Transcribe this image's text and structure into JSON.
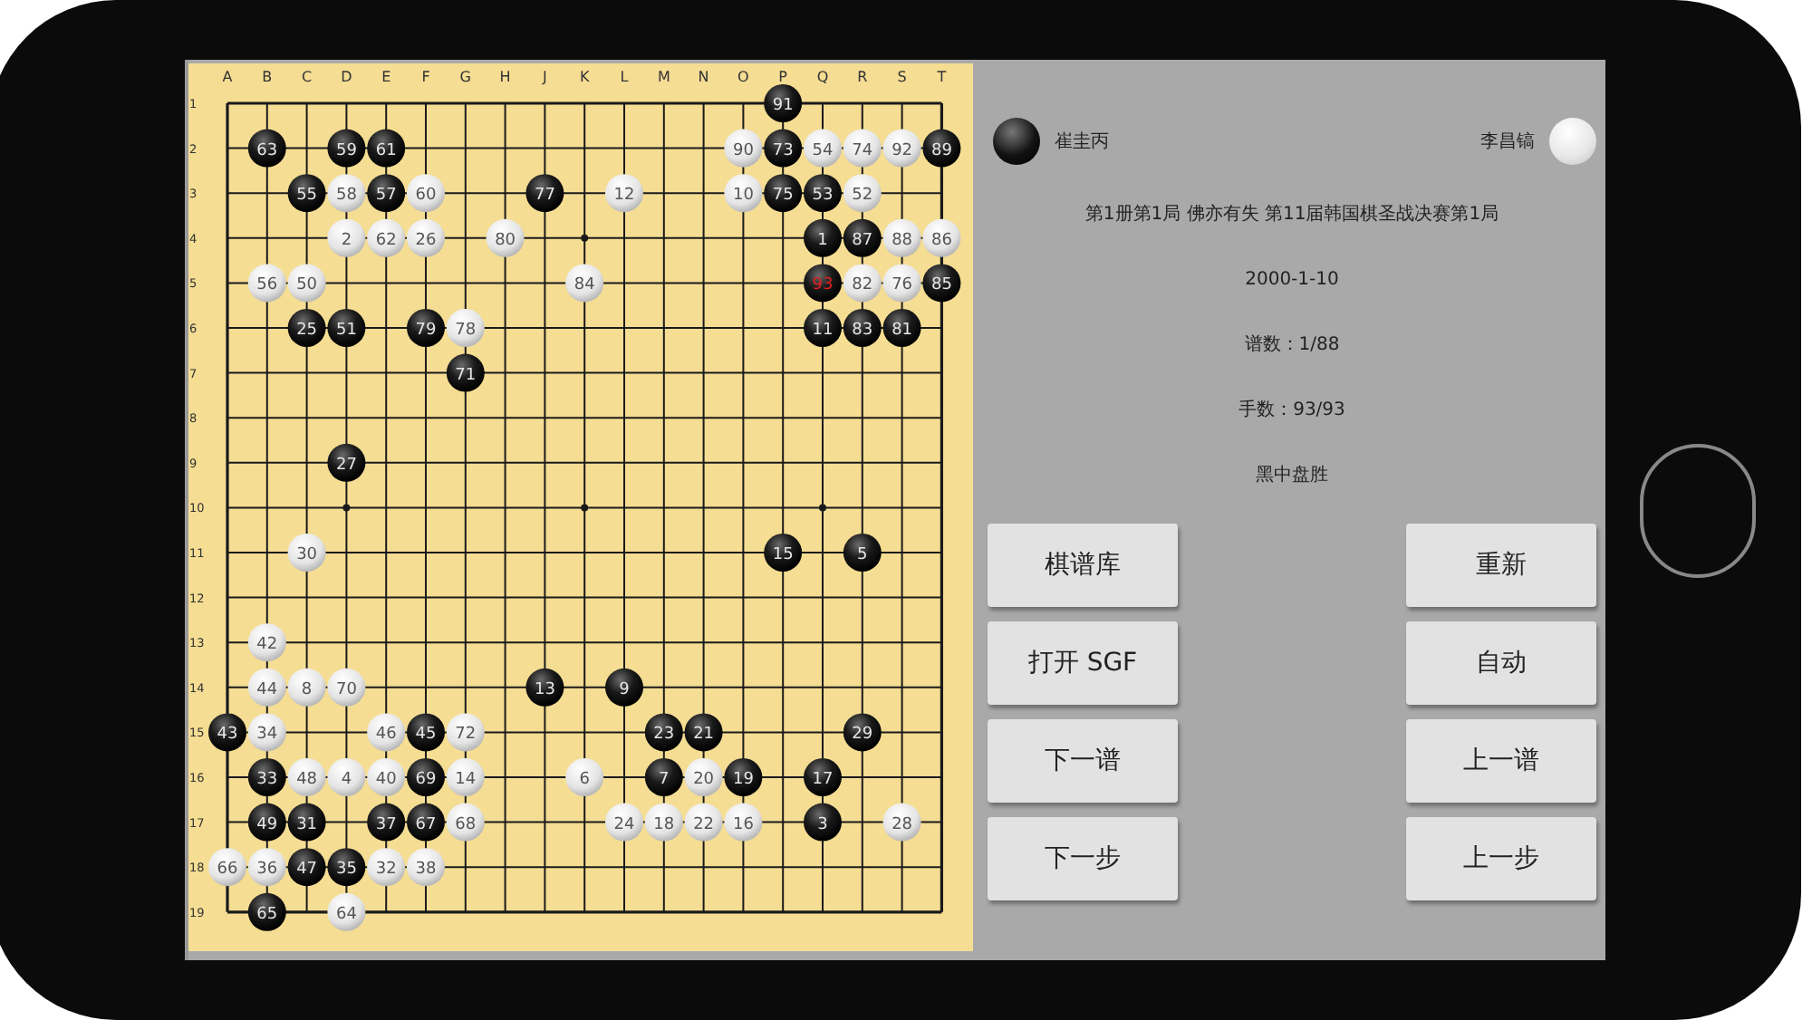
{
  "board": {
    "column_labels": [
      "A",
      "B",
      "C",
      "D",
      "E",
      "F",
      "G",
      "H",
      "J",
      "K",
      "L",
      "M",
      "N",
      "O",
      "P",
      "Q",
      "R",
      "S",
      "T"
    ],
    "row_labels": [
      "1",
      "2",
      "3",
      "4",
      "5",
      "6",
      "7",
      "8",
      "9",
      "10",
      "11",
      "12",
      "13",
      "14",
      "15",
      "16",
      "17",
      "18",
      "19"
    ],
    "rows": [
      [
        null,
        null,
        null,
        null,
        null,
        null,
        null,
        null,
        null,
        null,
        null,
        null,
        null,
        null,
        {
          "kind": "black",
          "number": "91"
        },
        null,
        null,
        null,
        null
      ],
      [
        null,
        {
          "kind": "black",
          "number": "63"
        },
        null,
        {
          "kind": "black",
          "number": "59"
        },
        {
          "kind": "black",
          "number": "61"
        },
        null,
        null,
        null,
        null,
        null,
        null,
        null,
        null,
        {
          "kind": "white",
          "number": "90"
        },
        {
          "kind": "black",
          "number": "73"
        },
        {
          "kind": "white",
          "number": "54"
        },
        {
          "kind": "white",
          "number": "74"
        },
        {
          "kind": "white",
          "number": "92"
        },
        {
          "kind": "black",
          "number": "89"
        }
      ],
      [
        null,
        null,
        {
          "kind": "black",
          "number": "55"
        },
        {
          "kind": "white",
          "number": "58"
        },
        {
          "kind": "black",
          "number": "57"
        },
        {
          "kind": "white",
          "number": "60"
        },
        null,
        null,
        {
          "kind": "black",
          "number": "77"
        },
        null,
        {
          "kind": "white",
          "number": "12"
        },
        null,
        null,
        {
          "kind": "white",
          "number": "10"
        },
        {
          "kind": "black",
          "number": "75"
        },
        {
          "kind": "black",
          "number": "53"
        },
        {
          "kind": "white",
          "number": "52"
        },
        null,
        null
      ],
      [
        null,
        null,
        null,
        {
          "kind": "white",
          "number": "2"
        },
        {
          "kind": "white",
          "number": "62"
        },
        {
          "kind": "white",
          "number": "26"
        },
        null,
        {
          "kind": "white",
          "number": "80"
        },
        null,
        null,
        null,
        null,
        null,
        null,
        null,
        {
          "kind": "black",
          "number": "1"
        },
        {
          "kind": "black",
          "number": "87"
        },
        {
          "kind": "white",
          "number": "88"
        },
        {
          "kind": "white",
          "number": "86"
        }
      ],
      [
        null,
        {
          "kind": "white",
          "number": "56"
        },
        {
          "kind": "white",
          "number": "50"
        },
        null,
        null,
        null,
        null,
        null,
        null,
        {
          "kind": "white",
          "number": "84"
        },
        null,
        null,
        null,
        null,
        null,
        {
          "kind": "black_last",
          "number": "93"
        },
        {
          "kind": "white",
          "number": "82"
        },
        {
          "kind": "white",
          "number": "76"
        },
        {
          "kind": "black",
          "number": "85"
        }
      ],
      [
        null,
        null,
        {
          "kind": "black",
          "number": "25"
        },
        {
          "kind": "black",
          "number": "51"
        },
        null,
        {
          "kind": "black",
          "number": "79"
        },
        {
          "kind": "white",
          "number": "78"
        },
        null,
        null,
        null,
        null,
        null,
        null,
        null,
        null,
        {
          "kind": "black",
          "number": "11"
        },
        {
          "kind": "black",
          "number": "83"
        },
        {
          "kind": "black",
          "number": "81"
        },
        null
      ],
      [
        null,
        null,
        null,
        null,
        null,
        null,
        {
          "kind": "black",
          "number": "71"
        },
        null,
        null,
        null,
        null,
        null,
        null,
        null,
        null,
        null,
        null,
        null,
        null
      ],
      [
        null,
        null,
        null,
        null,
        null,
        null,
        null,
        null,
        null,
        null,
        null,
        null,
        null,
        null,
        null,
        null,
        null,
        null,
        null
      ],
      [
        null,
        null,
        null,
        {
          "kind": "black",
          "number": "27"
        },
        null,
        null,
        null,
        null,
        null,
        null,
        null,
        null,
        null,
        null,
        null,
        null,
        null,
        null,
        null
      ],
      [
        null,
        null,
        null,
        null,
        null,
        null,
        null,
        null,
        null,
        null,
        null,
        null,
        null,
        null,
        null,
        null,
        null,
        null,
        null
      ],
      [
        null,
        null,
        {
          "kind": "white",
          "number": "30"
        },
        null,
        null,
        null,
        null,
        null,
        null,
        null,
        null,
        null,
        null,
        null,
        {
          "kind": "black",
          "number": "15"
        },
        null,
        {
          "kind": "black",
          "number": "5"
        },
        null,
        null
      ],
      [
        null,
        null,
        null,
        null,
        null,
        null,
        null,
        null,
        null,
        null,
        null,
        null,
        null,
        null,
        null,
        null,
        null,
        null,
        null
      ],
      [
        null,
        {
          "kind": "white",
          "number": "42"
        },
        null,
        null,
        null,
        null,
        null,
        null,
        null,
        null,
        null,
        null,
        null,
        null,
        null,
        null,
        null,
        null,
        null
      ],
      [
        null,
        {
          "kind": "white",
          "number": "44"
        },
        {
          "kind": "white",
          "number": "8"
        },
        {
          "kind": "white",
          "number": "70"
        },
        null,
        null,
        null,
        null,
        {
          "kind": "black",
          "number": "13"
        },
        null,
        {
          "kind": "black",
          "number": "9"
        },
        null,
        null,
        null,
        null,
        null,
        null,
        null,
        null
      ],
      [
        {
          "kind": "black",
          "number": "43"
        },
        {
          "kind": "white",
          "number": "34"
        },
        null,
        null,
        {
          "kind": "white",
          "number": "46"
        },
        {
          "kind": "black",
          "number": "45"
        },
        {
          "kind": "white",
          "number": "72"
        },
        null,
        null,
        null,
        null,
        {
          "kind": "black",
          "number": "23"
        },
        {
          "kind": "black",
          "number": "21"
        },
        null,
        null,
        null,
        {
          "kind": "black",
          "number": "29"
        },
        null,
        null
      ],
      [
        null,
        {
          "kind": "black",
          "number": "33"
        },
        {
          "kind": "white",
          "number": "48"
        },
        {
          "kind": "white",
          "number": "4"
        },
        {
          "kind": "white",
          "number": "40"
        },
        {
          "kind": "black",
          "number": "69"
        },
        {
          "kind": "white",
          "number": "14"
        },
        null,
        null,
        {
          "kind": "white",
          "number": "6"
        },
        null,
        {
          "kind": "black",
          "number": "7"
        },
        {
          "kind": "white",
          "number": "20"
        },
        {
          "kind": "black",
          "number": "19"
        },
        null,
        {
          "kind": "black",
          "number": "17"
        },
        null,
        null,
        null
      ],
      [
        null,
        {
          "kind": "black",
          "number": "49"
        },
        {
          "kind": "black",
          "number": "31"
        },
        null,
        {
          "kind": "black",
          "number": "37"
        },
        {
          "kind": "black",
          "number": "67"
        },
        {
          "kind": "white",
          "number": "68"
        },
        null,
        null,
        null,
        {
          "kind": "white",
          "number": "24"
        },
        {
          "kind": "white",
          "number": "18"
        },
        {
          "kind": "white",
          "number": "22"
        },
        {
          "kind": "white",
          "number": "16"
        },
        null,
        {
          "kind": "black",
          "number": "3"
        },
        null,
        {
          "kind": "white",
          "number": "28"
        },
        null
      ],
      [
        {
          "kind": "white",
          "number": "66"
        },
        {
          "kind": "white",
          "number": "36"
        },
        {
          "kind": "black",
          "number": "47"
        },
        {
          "kind": "black",
          "number": "35"
        },
        {
          "kind": "white",
          "number": "32"
        },
        {
          "kind": "white",
          "number": "38"
        },
        null,
        null,
        null,
        null,
        null,
        null,
        null,
        null,
        null,
        null,
        null,
        null,
        null
      ],
      [
        null,
        {
          "kind": "black",
          "number": "65"
        },
        null,
        {
          "kind": "white",
          "number": "64"
        },
        null,
        null,
        null,
        null,
        null,
        null,
        null,
        null,
        null,
        null,
        null,
        null,
        null,
        null,
        null
      ]
    ]
  },
  "players": [
    {
      "kind": "black",
      "name": "崔圭丙"
    },
    {
      "kind": "white",
      "name": "李昌镐"
    }
  ],
  "info": [
    "第1册第1局 佛亦有失 第11届韩国棋圣战决赛第1局",
    "2000-1-10",
    "谱数：1/88",
    "手数：93/93",
    "黑中盘胜"
  ],
  "buttons_left": [
    "棋谱库",
    "打开 SGF",
    "下一谱",
    "下一步"
  ],
  "buttons_right": [
    "重新",
    "自动",
    "上一谱",
    "上一步"
  ]
}
